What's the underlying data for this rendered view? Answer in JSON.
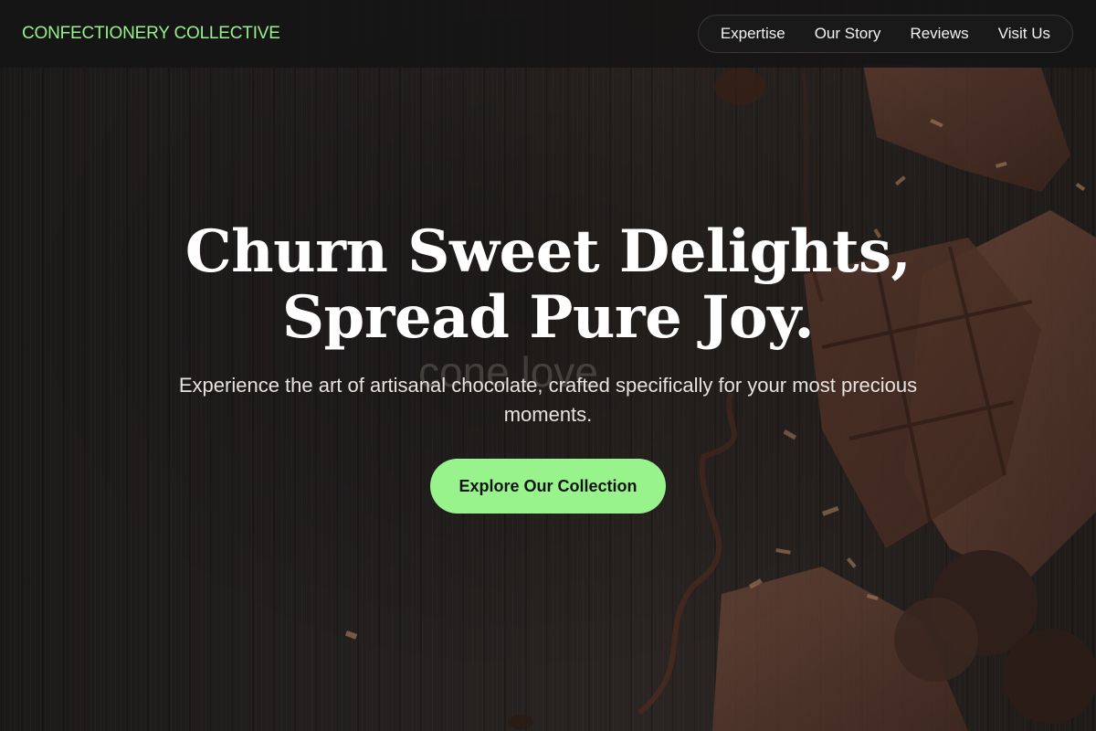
{
  "header": {
    "brand": "CONFECTIONERY COLLECTIVE",
    "nav": [
      {
        "label": "Expertise"
      },
      {
        "label": "Our Story"
      },
      {
        "label": "Reviews"
      },
      {
        "label": "Visit Us"
      }
    ]
  },
  "hero": {
    "headline_line1": "Churn Sweet Delights,",
    "headline_line2": "Spread Pure Joy.",
    "ghost_text": "cone love",
    "subtitle": "Experience the art of artisanal chocolate, crafted specifically for your most precious moments.",
    "cta_label": "Explore Our Collection"
  },
  "colors": {
    "accent": "#98f38d",
    "brand_text": "#98f08d",
    "background": "#1b1918",
    "header_bg": "#161515"
  },
  "images": {
    "hero_background": "dark-wood-with-chocolate-pieces"
  }
}
